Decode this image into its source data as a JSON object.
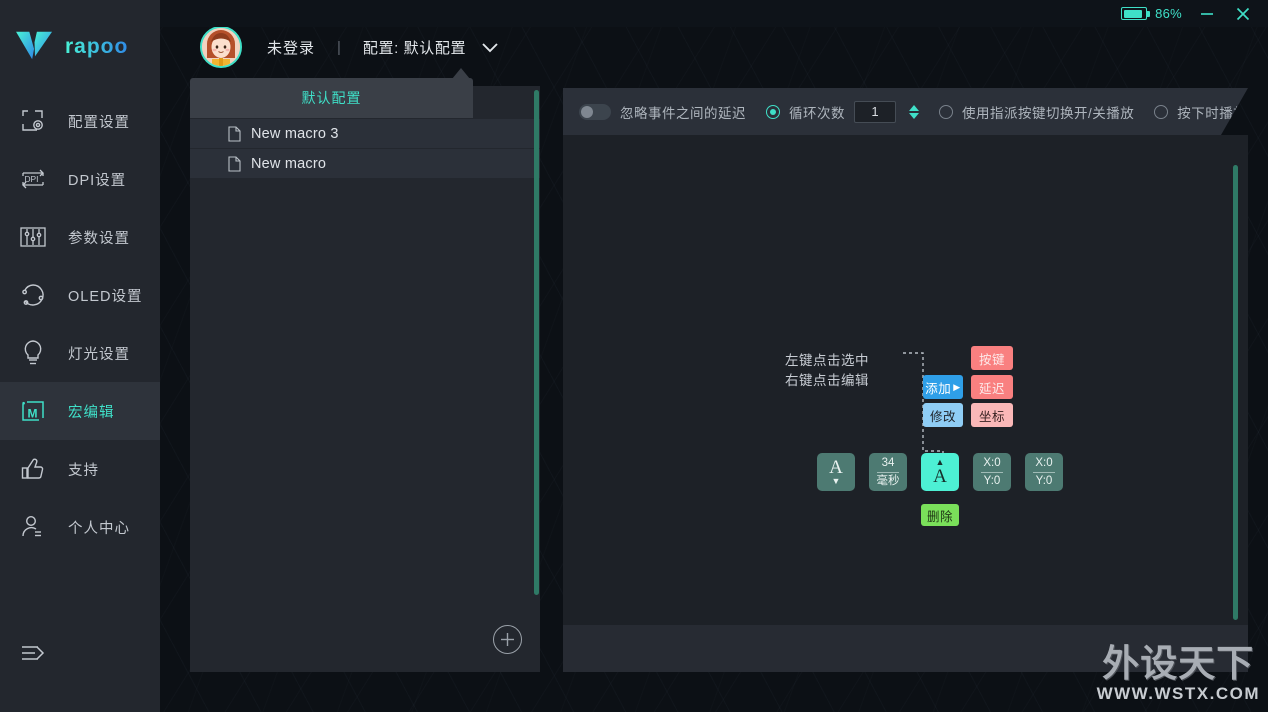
{
  "titlebar": {
    "battery_percent": "86%",
    "battery_level": 86,
    "minimize_label": "minimize",
    "close_label": "close"
  },
  "brand": {
    "name": "rapoo"
  },
  "sidebar": {
    "items": [
      {
        "icon": "profile-settings-icon",
        "label": "配置设置",
        "active": false
      },
      {
        "icon": "dpi-icon",
        "label": "DPI设置",
        "active": false
      },
      {
        "icon": "parameters-icon",
        "label": "参数设置",
        "active": false
      },
      {
        "icon": "oled-icon",
        "label": "OLED设置",
        "active": false
      },
      {
        "icon": "lighting-icon",
        "label": "灯光设置",
        "active": false
      },
      {
        "icon": "macro-icon",
        "label": "宏编辑",
        "active": true
      },
      {
        "icon": "thumbs-up-icon",
        "label": "支持",
        "active": false
      },
      {
        "icon": "user-icon",
        "label": "个人中心",
        "active": false
      }
    ],
    "collapse_icon": "collapse-menu-icon"
  },
  "userbar": {
    "avatar": "user-avatar",
    "login_status": "未登录",
    "separator": "|",
    "profile_text": "配置: 默认配置",
    "caret": "chevron-down-icon"
  },
  "dropdown": {
    "selected": "默认配置",
    "macros": [
      {
        "icon": "file-icon",
        "name": "New macro 3"
      },
      {
        "icon": "file-icon",
        "name": "New macro"
      }
    ],
    "add_button": "plus-icon"
  },
  "toolbar": {
    "ignore_delay_label": "忽略事件之间的延迟",
    "ignore_delay_on": false,
    "loop_label": "循环次数",
    "loop_selected": true,
    "loop_value": "1",
    "toggle_playback_label": "使用指派按键切换开/关播放",
    "toggle_playback_selected": false,
    "hold_play_label": "按下时播放",
    "hold_play_selected": false,
    "spinner_up": "spinner-up-icon",
    "spinner_down": "spinner-down-icon"
  },
  "editor": {
    "hint_line1": "左键点击选中",
    "hint_line2": "右键点击编辑",
    "context_menu": {
      "add": "添加",
      "add_caret": "▶",
      "modify": "修改",
      "key": "按键",
      "delay": "延迟",
      "coordinate": "坐标",
      "delete": "删除"
    },
    "events": [
      {
        "type": "key-up",
        "main": "A",
        "arrow": "▼",
        "arrow_pos": "bottom",
        "selected": false
      },
      {
        "type": "delay",
        "top": "34",
        "bottom": "毫秒",
        "selected": false
      },
      {
        "type": "key-down",
        "main": "A",
        "arrow": "▲",
        "arrow_pos": "top",
        "selected": true
      },
      {
        "type": "coordinate",
        "top": "X:0",
        "bottom": "Y:0",
        "selected": false
      },
      {
        "type": "coordinate",
        "top": "X:0",
        "bottom": "Y:0",
        "selected": false
      }
    ]
  },
  "watermark": {
    "cn": "外设天下",
    "url": "WWW.WSTX.COM"
  },
  "colors": {
    "accent": "#3fe0c8",
    "sidebar_bg": "#23272e",
    "panel_bg": "#1d2127",
    "tile": "#4d7a72",
    "tile_selected": "#4df0d4",
    "btn_add": "#2f9fe8",
    "btn_modify": "#8fcdf5",
    "btn_key": "#f98080",
    "btn_coord": "#fab8b8",
    "btn_delete": "#7ae05a"
  }
}
